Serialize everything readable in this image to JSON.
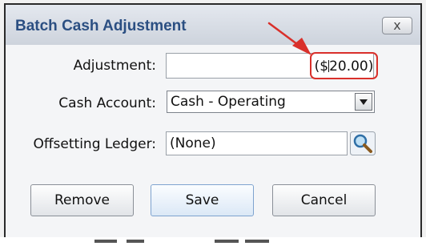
{
  "dialog": {
    "title": "Batch Cash Adjustment",
    "close_label": "x"
  },
  "form": {
    "adjustment": {
      "label": "Adjustment:",
      "value": "",
      "display_prefix": "($",
      "display_suffix": "20.00)"
    },
    "cash_account": {
      "label": "Cash Account:",
      "selected": "Cash - Operating"
    },
    "offsetting_ledger": {
      "label": "Offsetting Ledger:",
      "value": "(None)"
    }
  },
  "buttons": {
    "remove": "Remove",
    "save": "Save",
    "cancel": "Cancel"
  },
  "colors": {
    "title": "#2b4f82",
    "highlight": "#d9302b"
  },
  "icons": {
    "lookup": "magnifier-icon",
    "dropdown": "chevron-down-icon",
    "annotation": "arrow-icon"
  }
}
